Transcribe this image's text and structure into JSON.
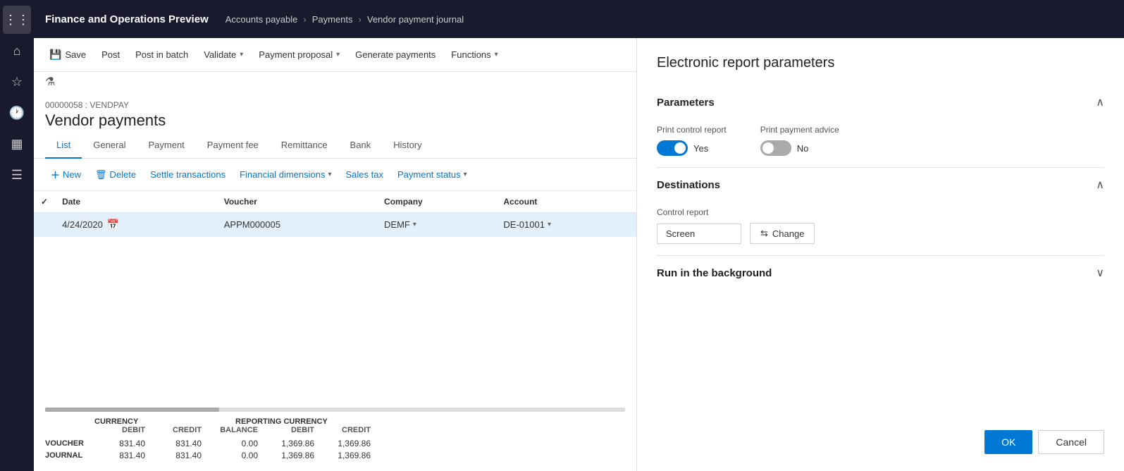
{
  "app": {
    "title": "Finance and Operations Preview",
    "help_icon": "?"
  },
  "breadcrumb": {
    "items": [
      "Accounts payable",
      "Payments",
      "Vendor payment journal"
    ]
  },
  "sidebar": {
    "icons": [
      "apps",
      "home",
      "star",
      "clock",
      "grid",
      "list"
    ]
  },
  "toolbar": {
    "save_label": "Save",
    "post_label": "Post",
    "post_batch_label": "Post in batch",
    "validate_label": "Validate",
    "payment_proposal_label": "Payment proposal",
    "generate_payments_label": "Generate payments",
    "functions_label": "Functions"
  },
  "journal": {
    "id": "00000058 : VENDPAY",
    "title": "Vendor payments"
  },
  "tabs": {
    "items": [
      "List",
      "General",
      "Payment",
      "Payment fee",
      "Remittance",
      "Bank",
      "History"
    ],
    "active": "List"
  },
  "actions": {
    "new_label": "New",
    "delete_label": "Delete",
    "settle_transactions_label": "Settle transactions",
    "financial_dimensions_label": "Financial dimensions",
    "sales_tax_label": "Sales tax",
    "payment_status_label": "Payment status"
  },
  "table": {
    "columns": [
      "Date",
      "Voucher",
      "Company",
      "Account"
    ],
    "rows": [
      {
        "date": "4/24/2020",
        "voucher": "APPM000005",
        "company": "DEMF",
        "account": "DE-01001"
      }
    ]
  },
  "summary": {
    "currency_label": "CURRENCY",
    "reporting_currency_label": "REPORTING CURRENCY",
    "col_headers": [
      "DEBIT",
      "CREDIT",
      "BALANCE",
      "DEBIT",
      "CREDIT"
    ],
    "rows": [
      {
        "label": "VOUCHER",
        "debit": "831.40",
        "credit": "831.40",
        "balance": "0.00",
        "rep_debit": "1,369.86",
        "rep_credit": "1,369.86"
      },
      {
        "label": "JOURNAL",
        "debit": "831.40",
        "credit": "831.40",
        "balance": "0.00",
        "rep_debit": "1,369.86",
        "rep_credit": "1,369.86"
      }
    ]
  },
  "right_panel": {
    "title": "Electronic report parameters",
    "sections": {
      "parameters": {
        "label": "Parameters",
        "print_control_report": {
          "label": "Print control report",
          "value": "Yes",
          "enabled": true
        },
        "print_payment_advice": {
          "label": "Print payment advice",
          "value": "No",
          "enabled": false
        }
      },
      "destinations": {
        "label": "Destinations",
        "control_report": {
          "label": "Control report",
          "value": "Screen",
          "change_label": "Change"
        }
      },
      "run_in_background": {
        "label": "Run in the background"
      }
    },
    "footer": {
      "ok_label": "OK",
      "cancel_label": "Cancel"
    }
  }
}
